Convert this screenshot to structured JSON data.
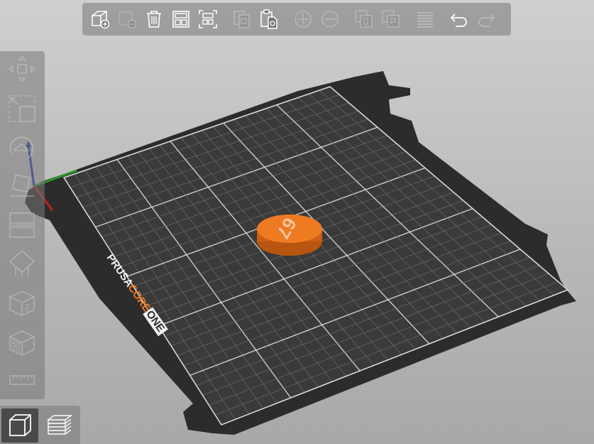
{
  "toolbar": {
    "buttons": [
      {
        "name": "add-object-icon",
        "enabled": true
      },
      {
        "name": "delete-object-icon",
        "enabled": false
      },
      {
        "name": "delete-all-icon",
        "enabled": true
      },
      {
        "name": "arrange-icon",
        "enabled": true
      },
      {
        "name": "arrange-selection-icon",
        "enabled": true
      },
      {
        "name": "copy-icon",
        "enabled": false
      },
      {
        "name": "paste-icon",
        "enabled": true
      },
      {
        "name": "add-instance-icon",
        "enabled": false
      },
      {
        "name": "remove-instance-icon",
        "enabled": false
      },
      {
        "name": "split-to-objects-icon",
        "enabled": false
      },
      {
        "name": "split-to-parts-icon",
        "enabled": false
      },
      {
        "name": "layers-editing-icon",
        "enabled": false
      },
      {
        "name": "undo-icon",
        "enabled": true
      },
      {
        "name": "redo-icon",
        "enabled": false
      }
    ]
  },
  "left_tools": [
    {
      "name": "move-icon",
      "enabled": false
    },
    {
      "name": "scale-icon",
      "enabled": false
    },
    {
      "name": "rotate-icon",
      "enabled": false
    },
    {
      "name": "place-on-face-icon",
      "enabled": false
    },
    {
      "name": "cut-icon",
      "enabled": false
    },
    {
      "name": "support-paint-icon",
      "enabled": false
    },
    {
      "name": "seam-paint-icon",
      "enabled": false
    },
    {
      "name": "fuzzy-skin-icon",
      "enabled": false
    },
    {
      "name": "measure-icon",
      "enabled": false
    }
  ],
  "bed": {
    "brand_prusa": "PRUSA",
    "brand_core": "CORE",
    "brand_one": "ONE",
    "model_label": "67",
    "colors": {
      "bed": "#2e2e2e",
      "grid": "#6a6a6a",
      "grid_major": "#e8e8e8",
      "model": "#e8731e",
      "brand_orange": "#f07820"
    }
  },
  "view_switch": [
    {
      "name": "3d-view-icon",
      "active": true
    },
    {
      "name": "preview-icon",
      "active": false
    }
  ]
}
